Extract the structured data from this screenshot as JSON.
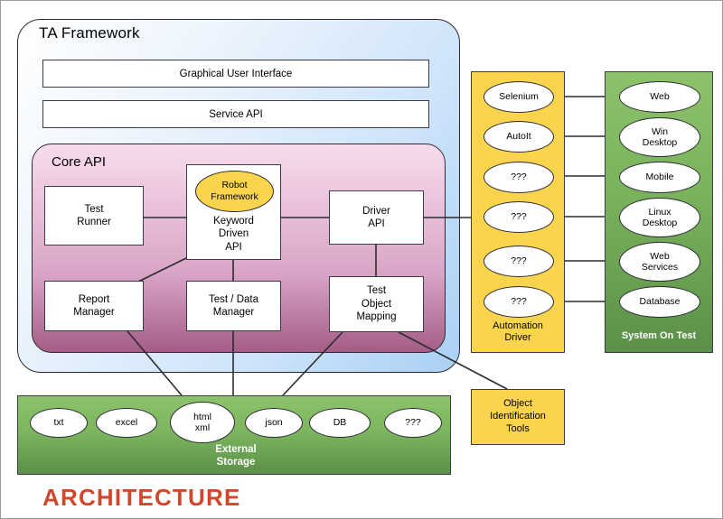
{
  "framework": {
    "title": "TA Framework",
    "bars": [
      {
        "label": "Graphical User Interface"
      },
      {
        "label": "Service API"
      }
    ]
  },
  "core_api": {
    "title": "Core API",
    "nodes": [
      {
        "id": "test-runner",
        "line1": "Test",
        "line2": "Runner"
      },
      {
        "id": "keyword-driven-api",
        "line1": "Keyword",
        "line2": "Driven",
        "line3": "API",
        "badge": "Robot Framework",
        "badge_line1": "Robot",
        "badge_line2": "Framework"
      },
      {
        "id": "driver-api",
        "line1": "Driver",
        "line2": "API"
      },
      {
        "id": "report-manager",
        "line1": "Report",
        "line2": "Manager"
      },
      {
        "id": "test-data-manager",
        "line1": "Test / Data",
        "line2": "Manager"
      },
      {
        "id": "test-object-mapping",
        "line1": "Test",
        "line2": "Object",
        "line3": "Mapping"
      }
    ]
  },
  "automation_driver": {
    "label_line1": "Automation",
    "label_line2": "Driver",
    "items": [
      {
        "label": "Selenium"
      },
      {
        "label": "AutoIt"
      },
      {
        "label": "???"
      },
      {
        "label": "???"
      },
      {
        "label": "???"
      },
      {
        "label": "???"
      }
    ]
  },
  "system_on_test": {
    "label": "System On Test",
    "items": [
      {
        "line1": "Web",
        "line2": ""
      },
      {
        "line1": "Win",
        "line2": "Desktop"
      },
      {
        "line1": "Mobile",
        "line2": ""
      },
      {
        "line1": "Linux",
        "line2": "Desktop"
      },
      {
        "line1": "Web",
        "line2": "Services"
      },
      {
        "line1": "Database",
        "line2": ""
      }
    ]
  },
  "object_identification_tools": {
    "line1": "Object",
    "line2": "Identification",
    "line3": "Tools"
  },
  "external_storage": {
    "label_line1": "External",
    "label_line2": "Storage",
    "items": [
      {
        "line1": "txt",
        "line2": ""
      },
      {
        "line1": "excel",
        "line2": ""
      },
      {
        "line1": "html",
        "line2": "xml"
      },
      {
        "line1": "json",
        "line2": ""
      },
      {
        "line1": "DB",
        "line2": ""
      },
      {
        "line1": "???",
        "line2": ""
      }
    ]
  },
  "footer": {
    "title": "ARCHITECTURE"
  },
  "colors": {
    "framework_blue": "#a9d0f5",
    "core_pink": "#d9a5c6",
    "accent_yellow": "#fbd44e",
    "green": "#7cb65f",
    "title_red": "#d2462a",
    "outline": "#2b2b33"
  }
}
